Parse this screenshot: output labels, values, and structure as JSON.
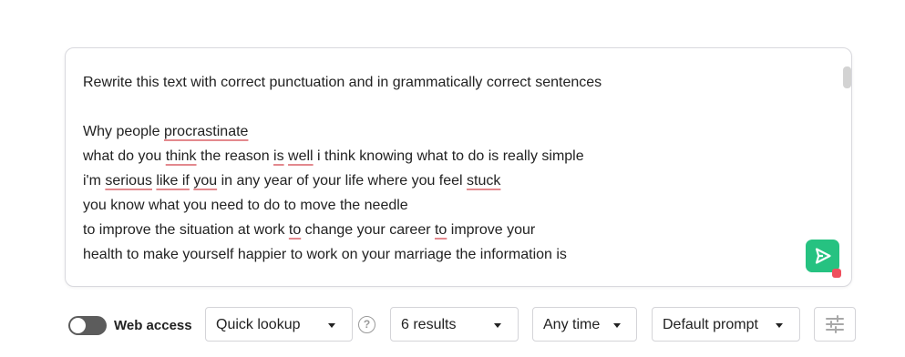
{
  "prompt": {
    "lines": [
      [
        {
          "t": "Rewrite this text with correct punctuation and in grammatically correct sentences"
        }
      ],
      [
        {
          "t": " "
        }
      ],
      [
        {
          "t": "Why people "
        },
        {
          "t": "procrastinate",
          "sp": true
        }
      ],
      [
        {
          "t": "what do you "
        },
        {
          "t": "think",
          "sp": true
        },
        {
          "t": " the reason "
        },
        {
          "t": "is",
          "sp": true
        },
        {
          "t": " "
        },
        {
          "t": "well",
          "sp": true
        },
        {
          "t": " i think knowing what to do is really simple"
        }
      ],
      [
        {
          "t": "i'm "
        },
        {
          "t": "serious",
          "sp": true
        },
        {
          "t": " "
        },
        {
          "t": "like if",
          "sp": true
        },
        {
          "t": " "
        },
        {
          "t": "you",
          "sp": true
        },
        {
          "t": " in any year of your life where you feel "
        },
        {
          "t": "stuck",
          "sp": true
        }
      ],
      [
        {
          "t": "you know what you need to do to move the needle"
        }
      ],
      [
        {
          "t": "to improve the situation at work "
        },
        {
          "t": "to",
          "sp": true
        },
        {
          "t": " change your career "
        },
        {
          "t": "to",
          "sp": true
        },
        {
          "t": " improve your"
        }
      ],
      [
        {
          "t": "health to make yourself happier to work on your marriage the information is"
        }
      ],
      [
        {
          "t": "                                                                                                    "
        }
      ]
    ]
  },
  "send_button": {
    "icon": "send-icon",
    "color": "#26c281"
  },
  "toolbar": {
    "web_access_label": "Web access",
    "web_access_on": false,
    "lookup_select": "Quick lookup",
    "help_symbol": "?",
    "results_select": "6 results",
    "time_select": "Any time",
    "prompt_select": "Default prompt",
    "settings_icon": "sliders-icon"
  }
}
